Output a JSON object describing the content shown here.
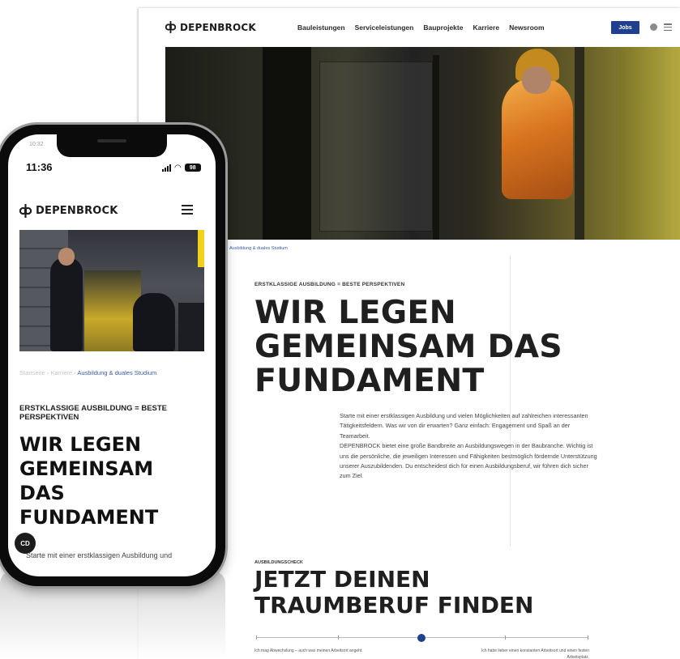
{
  "brand": {
    "name": "DEPENBROCK"
  },
  "desktop": {
    "nav": [
      "Bauleistungen",
      "Serviceleistungen",
      "Bauprojekte",
      "Karriere",
      "Newsroom"
    ],
    "jobs_button": "Jobs",
    "breadcrumb": "Ausbildung & duales Studium",
    "kicker": "ERSTKLASSIGE AUSBILDUNG = BESTE PERSPEKTIVEN",
    "title_lines": [
      "WIR LEGEN",
      "GEMEINSAM DAS",
      "FUNDAMENT"
    ],
    "body": [
      "Starte mit einer erstklassigen Ausbildung und vielen Möglichkeiten auf zahlreichen interessanten Tätigkeitsfeldern. Was wir von dir erwarten? Ganz einfach: Engagement und Spaß an der Teamarbeit.",
      "DEPENBROCK bietet eine große Bandbreite an Ausbildungswegen in der Baubranche. Wichtig ist uns die persönliche, die jeweiligen Interessen und Fähigkeiten bestmöglich fördernde Unterstützung unserer Auszubildenden. Du entscheidest dich für einen Ausbildungsberuf, wir führen dich sicher zum Ziel."
    ],
    "section2": {
      "kicker": "AUSBILDUNGSCHECK",
      "title_lines": [
        "JETZT DEINEN",
        "TRAUMBERUF FINDEN"
      ],
      "slider_left": "Ich mag Abwechslung – auch was meinen Arbeitsort angeht.",
      "slider_right": "Ich habe lieber einen konstanten Arbeitsort und einen festen Arbeitsplatz.",
      "slider_value": 0.5
    }
  },
  "mobile": {
    "status_time": "11:36",
    "ghost_time": "10:32",
    "battery": "98",
    "breadcrumb": [
      "Startseite",
      "Karriere",
      "Ausbildung & duales Studium"
    ],
    "kicker": "ERSTKLASSIGE AUSBILDUNG = BESTE PERSPEKTIVEN",
    "title_lines": [
      "WIR LEGEN",
      "GEMEINSAM",
      "DAS",
      "FUNDAMENT"
    ],
    "body_start": "Starte mit einer erstklassigen Ausbildung und",
    "fab_label": "CD"
  },
  "colors": {
    "accent": "#1f3f8f",
    "link": "#3a5aa8"
  }
}
